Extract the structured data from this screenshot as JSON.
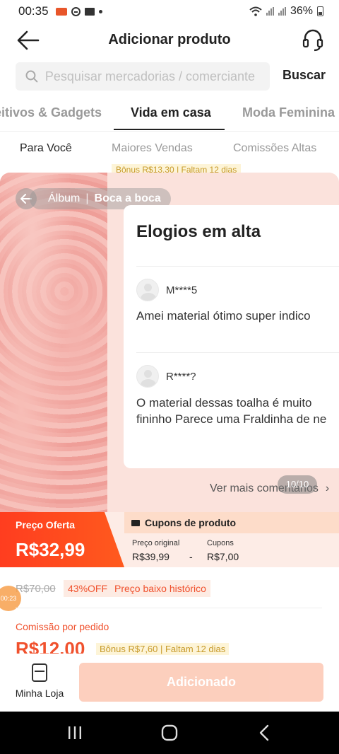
{
  "status_bar": {
    "time": "00:35",
    "battery": "36%"
  },
  "header": {
    "title": "Adicionar produto",
    "back_icon": "arrow-left-icon",
    "support_icon": "headset-icon"
  },
  "search": {
    "placeholder": "Pesquisar mercadorias / comerciante",
    "button_label": "Buscar"
  },
  "category_tabs": {
    "items": [
      {
        "label": "eitivos & Gadgets"
      },
      {
        "label": "Vida em casa"
      },
      {
        "label": "Moda Feminina"
      }
    ],
    "active_index": 1
  },
  "sub_tabs": {
    "items": [
      {
        "label": "Para Você"
      },
      {
        "label": "Maiores Vendas"
      },
      {
        "label": "Comissões Altas"
      }
    ],
    "active_index": 0
  },
  "peek_row": {
    "badge": "Bônus R$13,30 | Faltam 12 dias"
  },
  "album_overlay": {
    "tabs": [
      {
        "label": "Álbum"
      },
      {
        "label": "Boca a boca"
      }
    ],
    "active_tab_index": 1,
    "card_title": "Elogios em alta",
    "reviews": [
      {
        "name": "M****5",
        "text": "Amei material ótimo super indico"
      },
      {
        "name": "R****?",
        "text_lines": [
          "O material dessas toalha é muito",
          "fininho Parece uma Fraldinha de ne"
        ]
      }
    ],
    "counter": "10/10",
    "more_link": "Ver mais comentários"
  },
  "price_band": {
    "offer_label": "Preço Oferta",
    "offer_price": "R$32,99",
    "coupon_title": "Cupons de produto",
    "original_label": "Preço original",
    "original_value": "R$39,99",
    "coupons_label": "Cupons",
    "coupons_value": "R$7,00",
    "operator": "-"
  },
  "details": {
    "old_price": "R$70,00",
    "discount_tag": "43%OFF",
    "history_tag": "Preço baixo histórico",
    "float_badge": "00:23",
    "commission_label": "Comissão por pedido",
    "commission_value": "R$12,00",
    "bonus_tag": "Bônus R$7,60 | Faltam 12 dias"
  },
  "action_bar": {
    "store_label": "Minha Loja",
    "add_button": "Adicionado"
  },
  "colors": {
    "accent": "#ff4a1e",
    "overlay_bg": "#fbe2dc",
    "button_disabled": "#fcbfa8"
  }
}
